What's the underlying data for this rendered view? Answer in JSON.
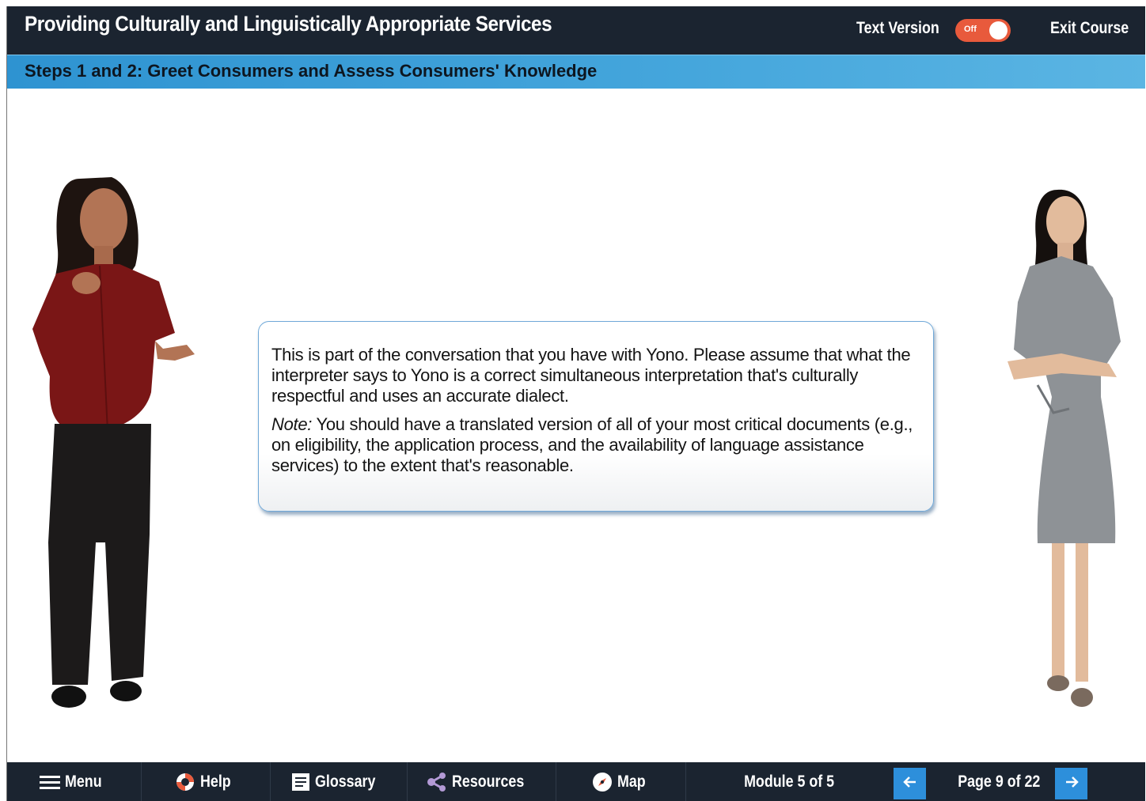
{
  "header": {
    "course_title": "Providing Culturally and Linguistically Appropriate Services",
    "text_version_label": "Text Version",
    "text_version_state": "Off",
    "exit_label": "Exit Course"
  },
  "page": {
    "title": "Steps 1 and 2: Greet Consumers and Assess Consumers' Knowledge"
  },
  "callout": {
    "paragraph1": "This is part of the conversation that you have with Yono. Please assume that what the interpreter says to Yono is a correct simultaneous interpretation that's culturally respectful and uses an accurate dialect.",
    "note_label": "Note:",
    "note_text": " You should have a translated version of all of your most critical documents (e.g., on eligibility, the application process, and the availability of language assistance services) to the extent that's reasonable."
  },
  "footer": {
    "menu_label": "Menu",
    "help_label": "Help",
    "glossary_label": "Glossary",
    "resources_label": "Resources",
    "map_label": "Map",
    "module_text": "Module 5 of 5",
    "page_text": "Page 9 of 22",
    "icons": {
      "menu": "hamburger-icon",
      "help": "lifebuoy-icon",
      "glossary": "book-icon",
      "resources": "share-icon",
      "map": "compass-icon",
      "prev": "arrow-left-icon",
      "next": "arrow-right-icon"
    }
  },
  "colors": {
    "header_bg": "#1b2430",
    "title_bar": "#45a6dc",
    "toggle_off": "#e85a3c",
    "nav_button": "#2d8fdb"
  }
}
